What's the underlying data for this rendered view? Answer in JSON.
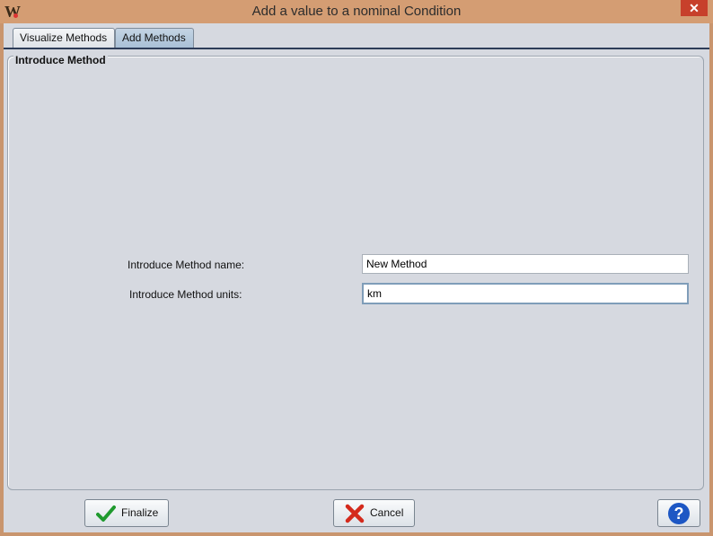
{
  "window": {
    "title": "Add a value to a nominal Condition",
    "app_icon_letter": "W",
    "close_glyph": "✕"
  },
  "tabs": [
    {
      "label": "Visualize Methods",
      "selected": false
    },
    {
      "label": "Add Methods",
      "selected": true
    }
  ],
  "panel": {
    "title": "Introduce Method",
    "fields": {
      "name_label": "Introduce Method name:",
      "name_value": "New Method",
      "units_label": "Introduce Method units:",
      "units_value": "km"
    }
  },
  "buttons": {
    "finalize": "Finalize",
    "cancel": "Cancel",
    "help_glyph": "?"
  },
  "colors": {
    "titlebar": "#d49d73",
    "accent_check": "#1f9a2e",
    "cancel_x": "#d42a1c",
    "help_blue": "#1d57c4"
  },
  "icons": [
    "app-logo-icon",
    "close-icon",
    "checkmark-icon",
    "cancel-x-icon",
    "help-icon"
  ]
}
